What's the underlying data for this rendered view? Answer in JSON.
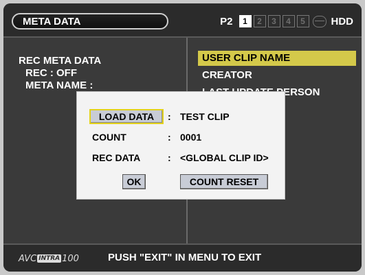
{
  "header": {
    "title": "META DATA",
    "media_label": "P2",
    "slots": [
      "1",
      "2",
      "3",
      "4",
      "5"
    ],
    "active_slot": "1",
    "drive_label": "HDD"
  },
  "left_pane": {
    "heading": "REC META DATA",
    "rec_status": "REC : OFF",
    "meta_name": "META NAME :"
  },
  "menu": {
    "items": [
      "USER CLIP NAME",
      "CREATOR",
      "LAST UPDATE PERSON"
    ],
    "selected_index": 0
  },
  "dialog": {
    "rows": [
      {
        "label": "LOAD DATA",
        "colon": ":",
        "value": "TEST CLIP"
      },
      {
        "label": "COUNT",
        "colon": ":",
        "value": "0001"
      },
      {
        "label": "REC DATA",
        "colon": ":",
        "value": "<GLOBAL CLIP ID>"
      }
    ],
    "ok_label": "OK",
    "reset_label": "COUNT RESET"
  },
  "footer": {
    "logo_prefix": "AVC",
    "logo_badge": "INTRA",
    "logo_suffix": "100",
    "message": "PUSH \"EXIT\" IN MENU TO EXIT"
  },
  "colors": {
    "selection": "#d4c94a",
    "focus_border": "#e3d21a",
    "button_face": "#c8ccd6",
    "screen_bg": "#3a3a3a"
  }
}
